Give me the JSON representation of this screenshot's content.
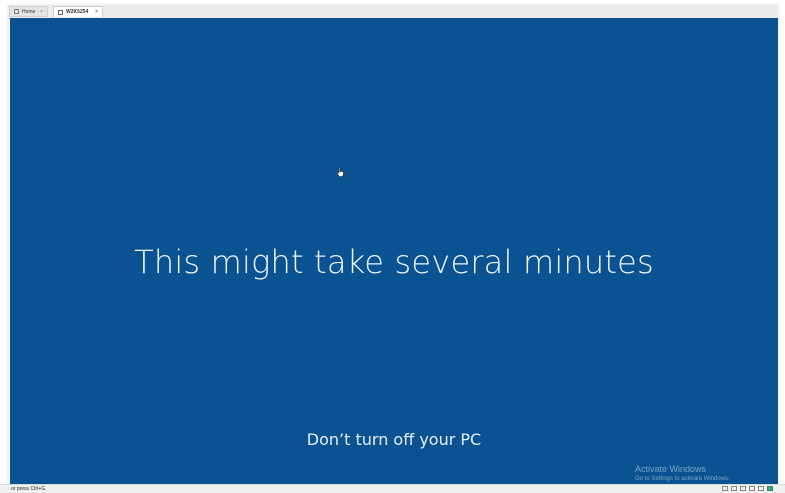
{
  "tabs": [
    {
      "label": "Home",
      "icon": "home-icon"
    },
    {
      "label": "W2K5254",
      "icon": "vm-icon"
    }
  ],
  "screen": {
    "background": "#0b5293",
    "headline": "This might take several minutes",
    "subline": "Don’t turn off your PC"
  },
  "watermark": {
    "line1": "Activate Windows",
    "line2": "Go to Settings to activate Windows."
  },
  "status_bar": {
    "text": "or press Ctrl+G."
  }
}
